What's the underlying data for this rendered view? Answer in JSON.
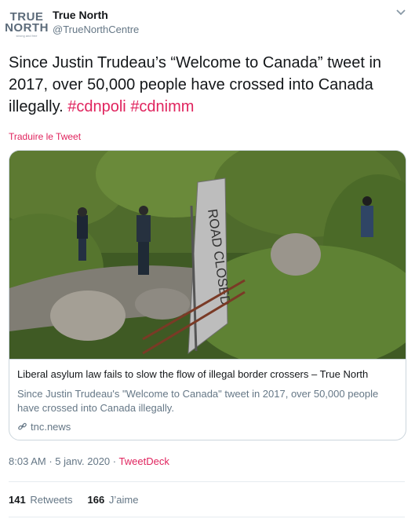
{
  "account": {
    "avatar_line1": "TRUE",
    "avatar_line2": "NORTH",
    "avatar_tagline": "strong and free",
    "display_name": "True North",
    "handle": "@TrueNorthCentre"
  },
  "tweet": {
    "text": "Since Justin Trudeau’s “Welcome to Canada” tweet in 2017, over 50,000 people have crossed into Canada illegally.",
    "hashtags": [
      "#cdnpoli",
      "#cdnimm"
    ],
    "translate_label": "Traduire le Tweet"
  },
  "card": {
    "image_sign_text": "ROAD CLOSED",
    "title": "Liberal asylum law fails to slow the flow of illegal border crossers – True North",
    "description": "Since Justin Trudeau's \"Welcome to Canada\" tweet in 2017, over 50,000 people have crossed into Canada illegally.",
    "domain": "tnc.news"
  },
  "meta": {
    "time": "8:03 AM",
    "date": "5 janv. 2020",
    "source": "TweetDeck",
    "separator": "·"
  },
  "stats": {
    "retweets_count": "141",
    "retweets_label": "Retweets",
    "likes_count": "166",
    "likes_label": "J’aime"
  },
  "colors": {
    "accent": "#e0245e",
    "muted": "#657786",
    "border": "#ccd6dd"
  }
}
